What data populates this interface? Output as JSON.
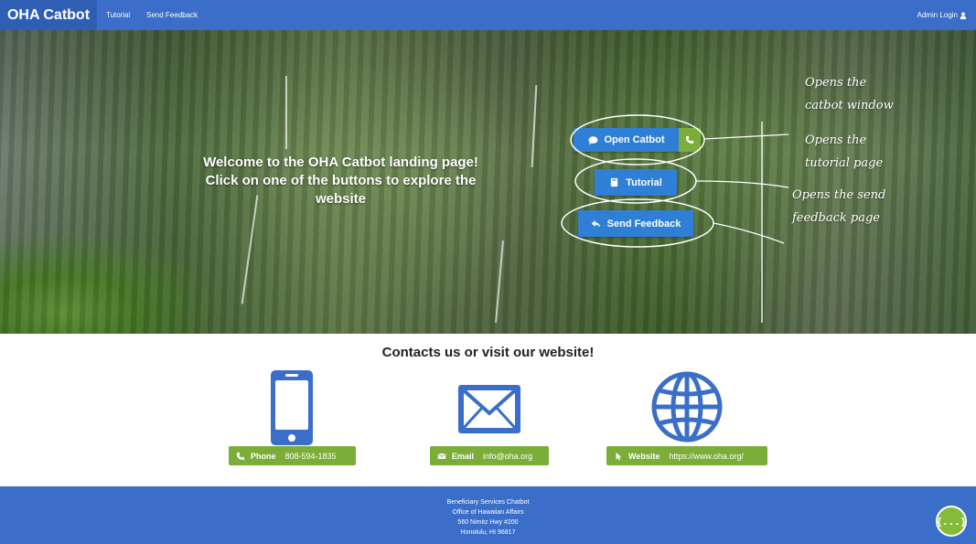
{
  "navbar": {
    "brand": "OHA Catbot",
    "links": [
      "Tutorial",
      "Send Feedback"
    ],
    "admin_login": "Admin Login",
    "admin_icon": "user-icon",
    "color": "#3a6ec8"
  },
  "hero": {
    "welcome_line1": "Welcome to the OHA Catbot landing page!",
    "welcome_line2": "Click on one of the buttons to explore the",
    "welcome_line3": "website",
    "buttons": {
      "open_catbot": "Open Catbot",
      "tutorial": "Tutorial",
      "send_feedback": "Send Feedback"
    },
    "button_color": "#2f7fd6",
    "annotations": {
      "catbot_1": "Opens the",
      "catbot_2": "catbot window",
      "tutorial_1": "Opens the",
      "tutorial_2": "tutorial page",
      "feedback_1": "Opens the send",
      "feedback_2": "feedback page"
    }
  },
  "contacts": {
    "title": "Contacts us or visit our website!",
    "items": [
      {
        "label": "Phone",
        "value": "808-594-1835",
        "icon": "phone-icon"
      },
      {
        "label": "Email",
        "value": "info@oha.org",
        "icon": "envelope-icon"
      },
      {
        "label": "Website",
        "value": "https://www.oha.org/",
        "icon": "globe-icon"
      }
    ],
    "accent": "#7aae38",
    "icon_color": "#3a6ec8"
  },
  "footer": {
    "lines": [
      "Beneficiary Services Chatbot",
      "Office of Hawaiian Affairs",
      "560 Nimitz Hwy #200",
      "Honolulu, HI 96817"
    ],
    "chat_button": "{...}",
    "color": "#3a6ec8"
  }
}
